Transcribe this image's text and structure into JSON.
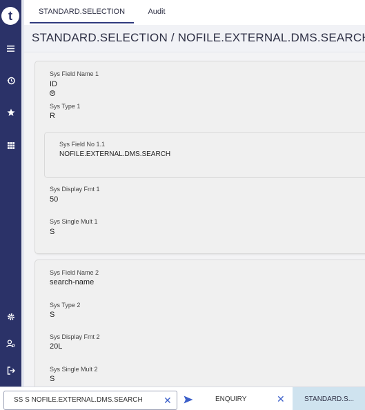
{
  "tabs": [
    {
      "label": "STANDARD.SELECTION",
      "active": true
    },
    {
      "label": "Audit",
      "active": false
    }
  ],
  "header": {
    "title": "STANDARD.SELECTION / NOFILE.EXTERNAL.DMS.SEARCH"
  },
  "sidebar": {
    "logo": "t",
    "top_icons": [
      "menu-icon",
      "history-icon",
      "star-icon",
      "grid-icon"
    ],
    "bottom_icons": [
      "settings-icon",
      "user-settings-icon",
      "logout-icon"
    ]
  },
  "cards": [
    {
      "field_name_label": "Sys Field Name 1",
      "field_name_value": "ID",
      "type_label": "Sys Type 1",
      "type_value": "R",
      "field_no_label": "Sys Field No 1.1",
      "field_no_value": "NOFILE.EXTERNAL.DMS.SEARCH",
      "display_fmt_label": "Sys Display Fmt 1",
      "display_fmt_value": "50",
      "single_mult_label": "Sys Single Mult 1",
      "single_mult_value": "S"
    },
    {
      "field_name_label": "Sys Field Name 2",
      "field_name_value": "search-name",
      "type_label": "Sys Type 2",
      "type_value": "S",
      "display_fmt_label": "Sys Display Fmt 2",
      "display_fmt_value": "20L",
      "single_mult_label": "Sys Single Mult 2",
      "single_mult_value": "S"
    }
  ],
  "bottom": {
    "command_value": "SS S NOFILE.EXTERNAL.DMS.SEARCH",
    "clear_symbol": "✕",
    "enquiry_label": "ENQUIRY",
    "enquiry_close": "✕",
    "standard_tab_label": "STANDARD.S..."
  },
  "colors": {
    "sidebar": "#2b3268",
    "accent": "#3b5fc9",
    "active_tab": "#cfe3ef"
  }
}
